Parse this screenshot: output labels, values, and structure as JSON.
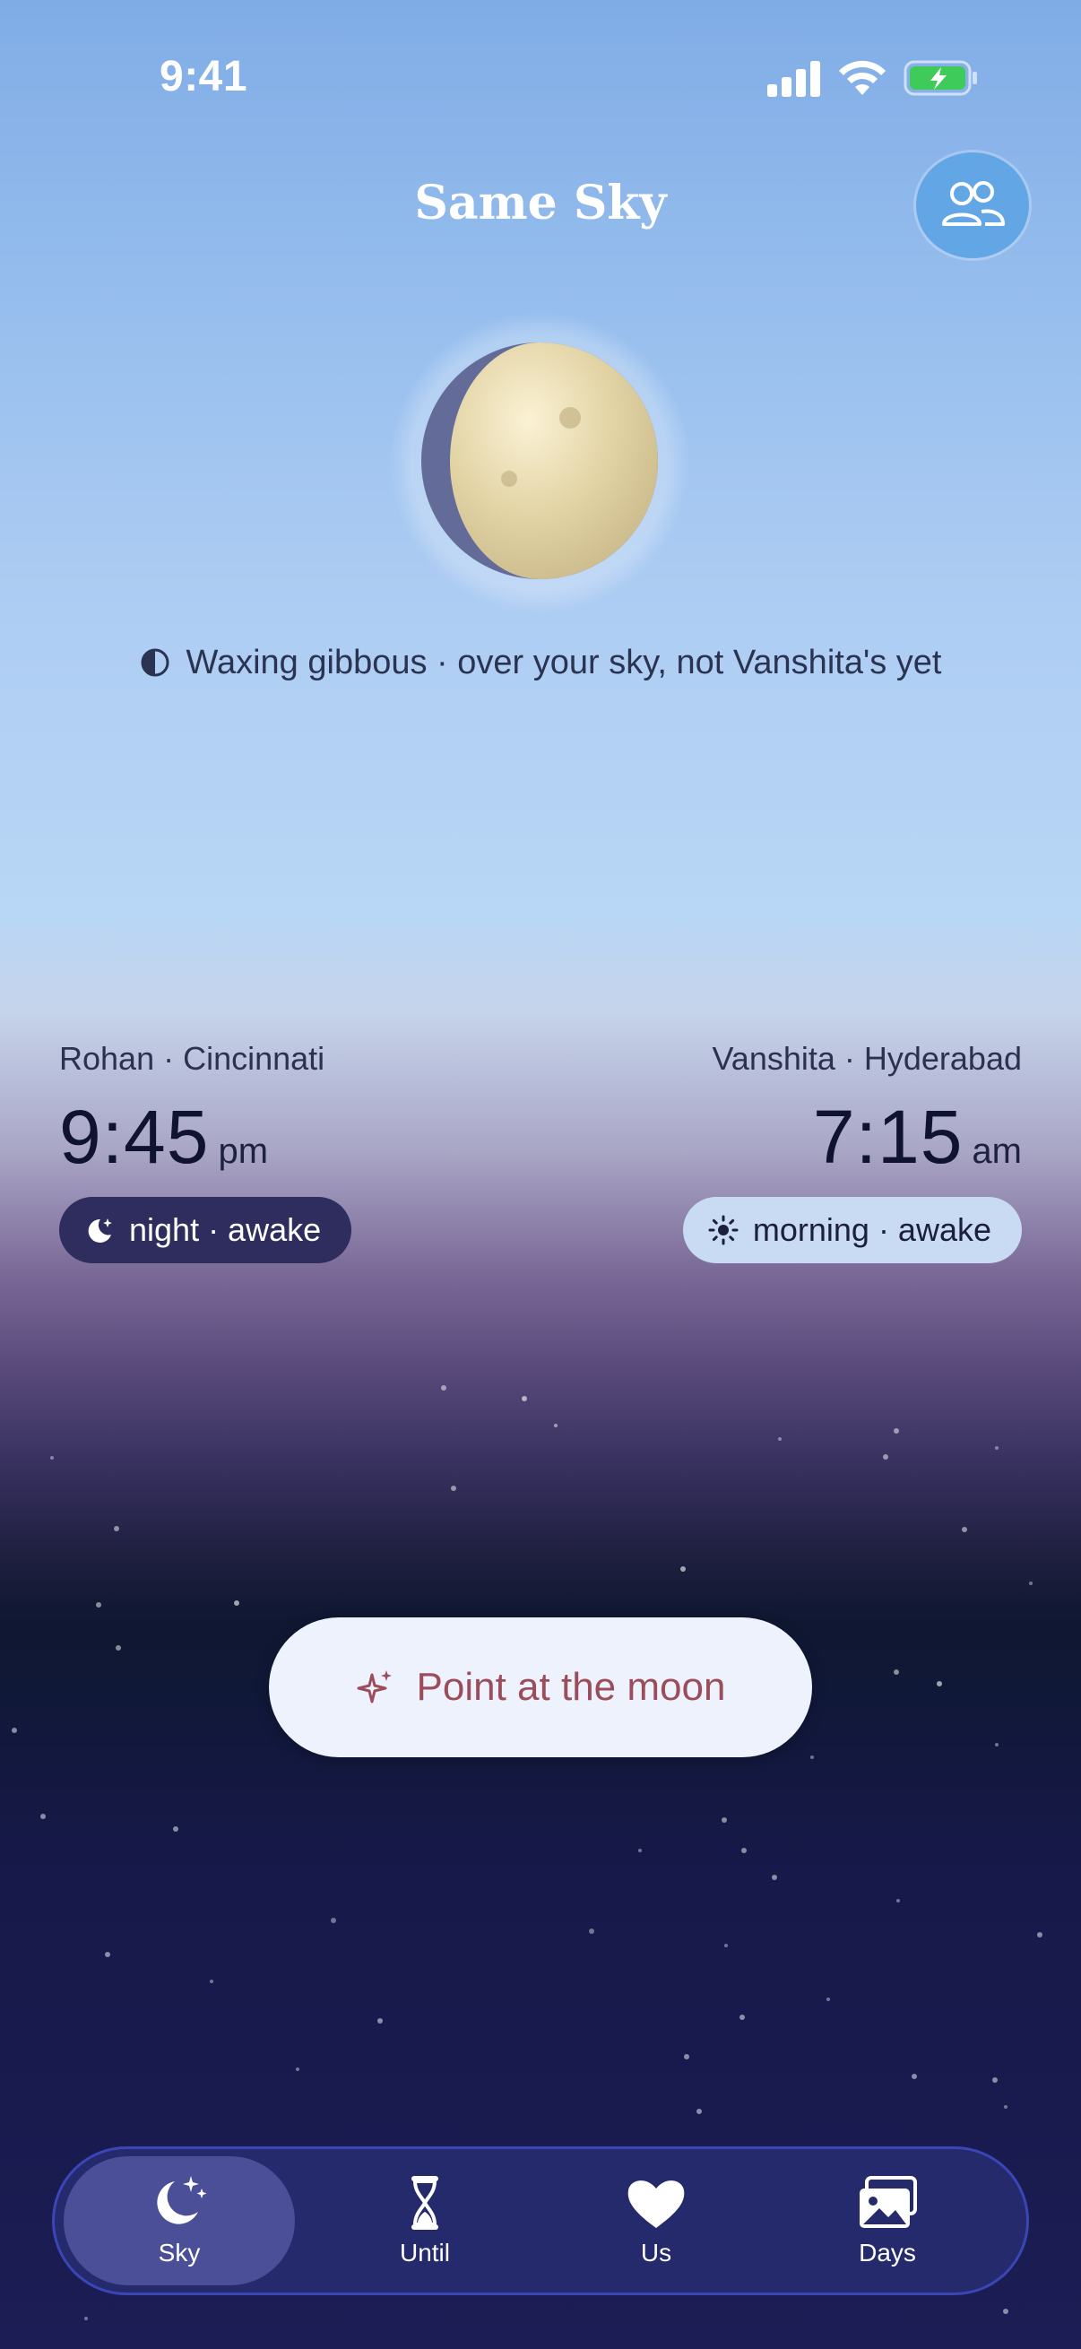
{
  "status_bar": {
    "time": "9:41",
    "icons": [
      "cellular-signal-icon",
      "wifi-icon",
      "battery-charging-icon"
    ]
  },
  "header": {
    "title": "Same Sky",
    "profile_icon": "two-people-icon"
  },
  "moon": {
    "phase_text": "Waxing gibbous · over your sky, not Vanshita's yet",
    "phase_icon": "half-moon-icon"
  },
  "people": [
    {
      "name_location": "Rohan · Cincinnati",
      "time": "9:45",
      "ampm": "pm",
      "status": "night · awake",
      "status_icon": "moon-icon"
    },
    {
      "name_location": "Vanshita · Hyderabad",
      "time": "7:15",
      "ampm": "am",
      "status": "morning · awake",
      "status_icon": "sun-icon"
    }
  ],
  "cta": {
    "label": "Point at the moon",
    "icon": "sparkle-icon"
  },
  "tabs": [
    {
      "label": "Sky",
      "icon": "moon-stars-icon",
      "active": true
    },
    {
      "label": "Until",
      "icon": "hourglass-icon",
      "active": false
    },
    {
      "label": "Us",
      "icon": "heart-icon",
      "active": false
    },
    {
      "label": "Days",
      "icon": "photos-icon",
      "active": false
    }
  ],
  "colors": {
    "accent": "#9c4d5b",
    "tab_bar": "#252a6c",
    "tab_active": "#4a4f98",
    "night_badge": "#2e2d5e",
    "morning_badge": "#c9daf3"
  }
}
